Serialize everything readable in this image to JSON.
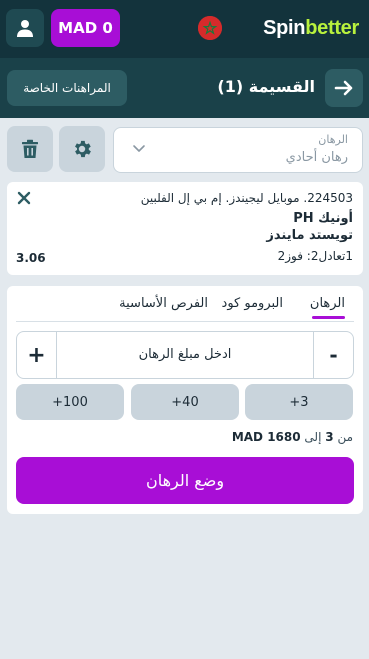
{
  "header": {
    "logo_part1": "Spin",
    "logo_part2": "better",
    "balance": "MAD 0",
    "country": "Morocco",
    "icons": {
      "user": "user-icon",
      "flag": "morocco-flag-icon"
    }
  },
  "subheader": {
    "title": "القسيمة (1)",
    "private_bets_label": "المراهنات الخاصة",
    "icons": {
      "back": "arrow-right-icon"
    }
  },
  "bet_type": {
    "label": "الرهان",
    "value": "رهان أحادي",
    "icons": {
      "dropdown": "chevron-down-icon",
      "settings": "gear-icon",
      "clear": "trash-icon"
    }
  },
  "bet": {
    "event": "224503. موبايل ليجيندز. إم بي إل الفلبين",
    "team1": "أونيك PH",
    "team2": "تويستد مايندز",
    "outcome": "1تعادل2: فوز2",
    "odds": "3.06",
    "icons": {
      "remove": "close-icon"
    }
  },
  "stake": {
    "tabs": [
      "الرهان",
      "البرومو كود",
      "الفرص الأساسية"
    ],
    "active_tab": "الرهان",
    "placeholder": "ادخل مبلغ الرهان",
    "minus_label": "-",
    "plus_label": "+",
    "quick_amounts": [
      "+100",
      "+40",
      "+3"
    ],
    "range_prefix": "من",
    "range_min": "3",
    "range_mid": "إلى",
    "range_max": "MAD 1680",
    "place_bet_label": "وضع الرهان"
  },
  "colors": {
    "header_bg": "#13333c",
    "subheader_bg": "#1a4149",
    "accent": "#a80ed6",
    "logo_green": "#b8f13d",
    "page_bg": "#e3e9ee"
  }
}
